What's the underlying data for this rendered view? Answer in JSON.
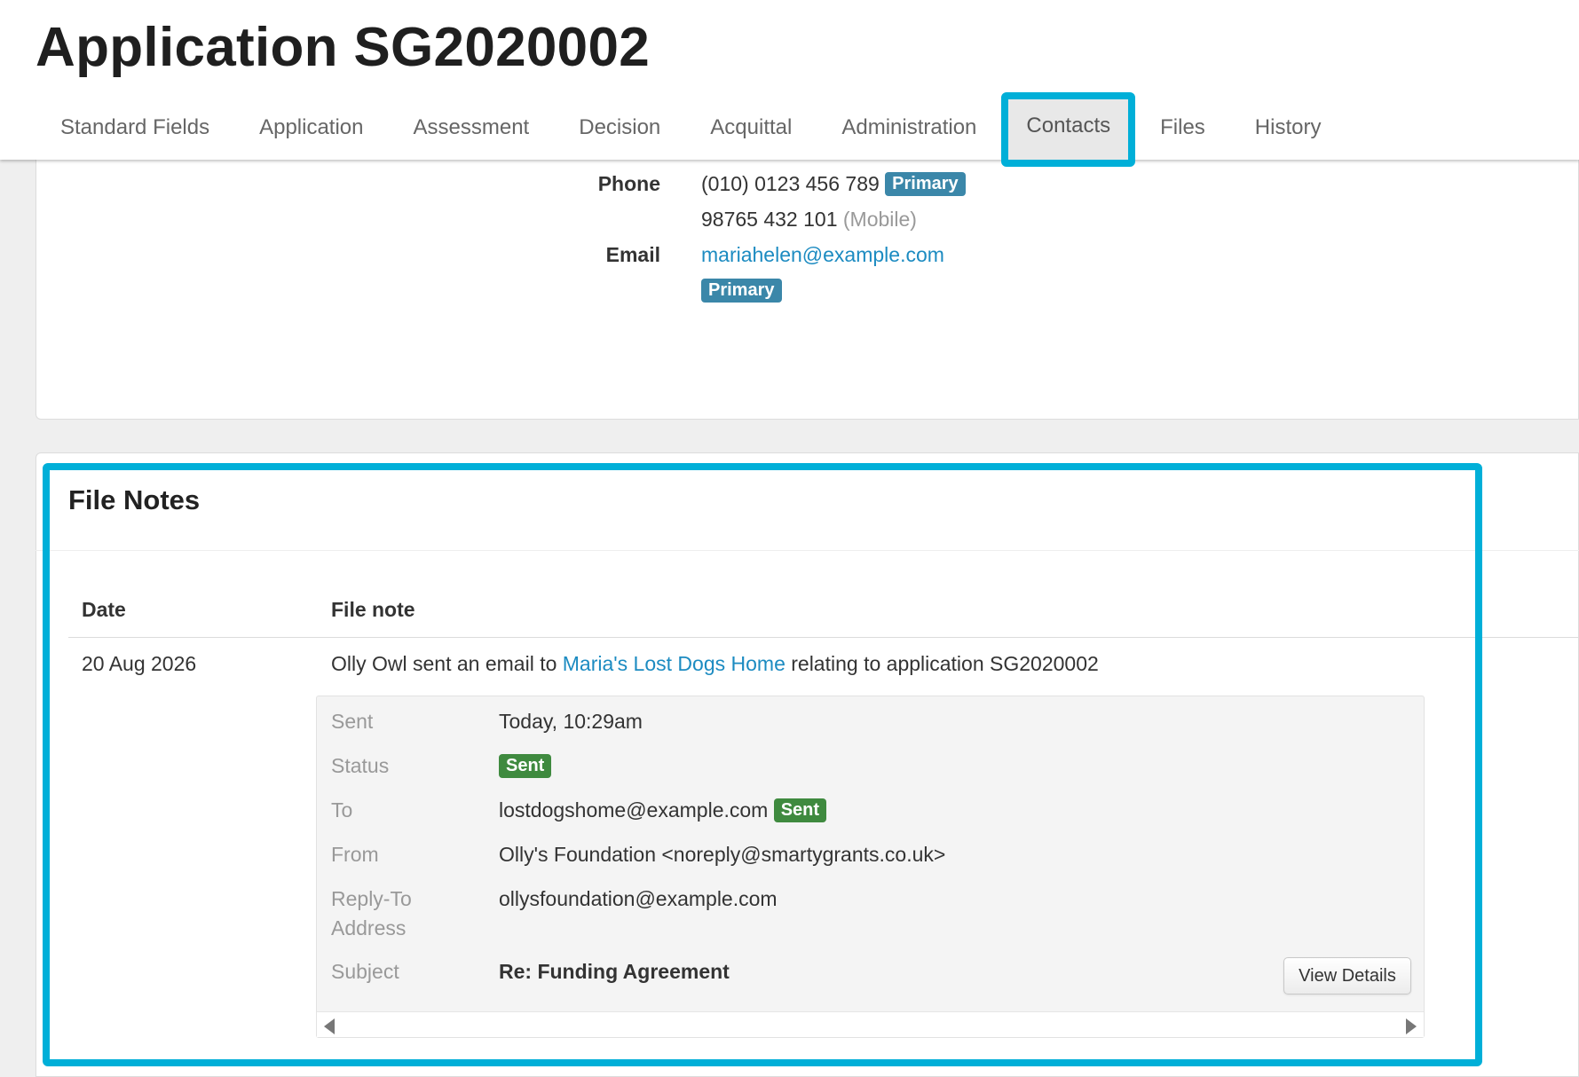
{
  "page": {
    "title": "Application SG2020002"
  },
  "tabs": [
    {
      "label": "Standard Fields"
    },
    {
      "label": "Application"
    },
    {
      "label": "Assessment"
    },
    {
      "label": "Decision"
    },
    {
      "label": "Acquittal"
    },
    {
      "label": "Administration"
    },
    {
      "label": "Contacts",
      "active": true
    },
    {
      "label": "Files"
    },
    {
      "label": "History"
    }
  ],
  "contact": {
    "phone_label": "Phone",
    "phone_primary": "(010) 0123 456 789",
    "phone_primary_badge": "Primary",
    "phone_mobile": "98765 432 101",
    "phone_mobile_type": "(Mobile)",
    "email_label": "Email",
    "email": "mariahelen@example.com",
    "email_badge": "Primary"
  },
  "file_notes": {
    "title": "File Notes",
    "columns": {
      "date": "Date",
      "note": "File note"
    },
    "rows": [
      {
        "date": "20 Aug 2026",
        "note_prefix": "Olly Owl sent an email to ",
        "note_link": "Maria's Lost Dogs Home",
        "note_suffix": " relating to application SG2020002",
        "email": {
          "sent_label": "Sent",
          "sent_value": "Today, 10:29am",
          "status_label": "Status",
          "status_badge": "Sent",
          "to_label": "To",
          "to_value": "lostdogshome@example.com",
          "to_badge": "Sent",
          "from_label": "From",
          "from_value": "Olly's Foundation <noreply@smartygrants.co.uk>",
          "reply_to_label_line1": "Reply-To",
          "reply_to_label_line2": "Address",
          "reply_to_value": "ollysfoundation@example.com",
          "subject_label": "Subject",
          "subject_value": "Re: Funding Agreement",
          "view_details_label": "View Details"
        }
      }
    ]
  },
  "colors": {
    "highlight": "#00afd8",
    "primary_badge": "#3b87a9",
    "sent_badge": "#3f8a3f",
    "link": "#1c8bc1"
  },
  "icons": [
    "scroll-left-arrow-icon",
    "scroll-right-arrow-icon"
  ]
}
